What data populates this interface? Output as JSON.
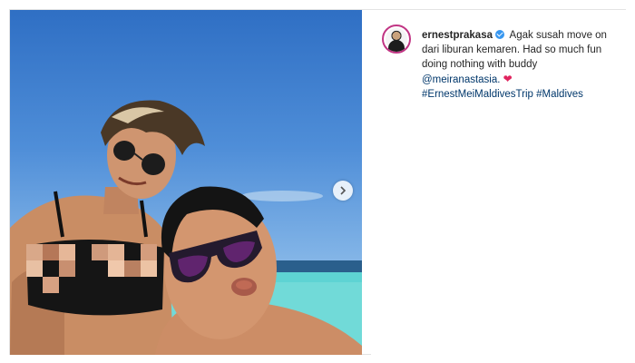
{
  "post": {
    "username": "ernestprakasa",
    "caption_text": " Agak susah move on dari liburan kemaren. Had so much fun doing nothing with buddy ",
    "mention": "@meiranastasia.",
    "hashtag_1": "#ErnestMeiMaldivesTrip",
    "hashtag_2": "#Maldives",
    "heart_glyph": "❤",
    "verified_icon": "verified-badge-icon",
    "next_icon": "chevron-right-icon"
  },
  "colors": {
    "link": "#00376b",
    "verified": "#3897f0",
    "heart": "#e0245e",
    "avatar_ring": "#c13584"
  }
}
